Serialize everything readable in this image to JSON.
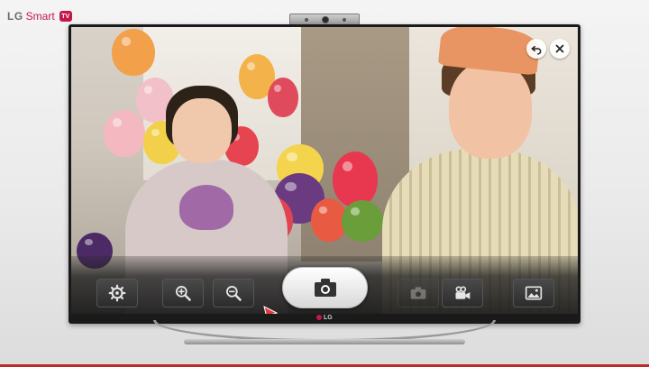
{
  "brand": {
    "company": "LG",
    "product": "Smart",
    "badge": "TV"
  },
  "bezel_logo": "LG",
  "video_overlay": {
    "top_controls": [
      {
        "name": "back",
        "icon": "back-arrow-icon"
      },
      {
        "name": "close",
        "icon": "close-icon"
      }
    ],
    "toolbar": {
      "buttons": [
        {
          "name": "settings",
          "icon": "gear-icon",
          "enabled": true
        },
        {
          "name": "zoom_in",
          "icon": "zoom-in-icon",
          "enabled": true
        },
        {
          "name": "zoom_out",
          "icon": "zoom-out-icon",
          "enabled": true
        },
        {
          "name": "capture",
          "icon": "camera-icon",
          "enabled": true,
          "selected": true
        },
        {
          "name": "photo_mode",
          "icon": "camera-icon",
          "enabled": false
        },
        {
          "name": "video_mode",
          "icon": "video-camera-icon",
          "enabled": true
        },
        {
          "name": "gallery",
          "icon": "gallery-icon",
          "enabled": true
        }
      ]
    }
  },
  "colors": {
    "brand_red": "#c5174a",
    "toolbar_bg": "#2c2c2c",
    "capture_bg": "#ffffff"
  }
}
